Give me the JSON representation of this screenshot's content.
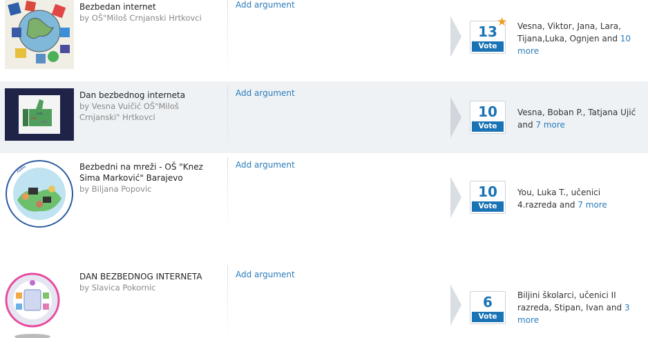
{
  "entries": [
    {
      "title": "Bezbedan internet",
      "byline": "by OŠ\"Miloš Crnjanski Hrtkovci",
      "add_argument": "Add argument",
      "votes": "13",
      "vote_label": "Vote",
      "voters": "Vesna, Viktor, Jana, Lara, Tijana,Luka, Ognjen and",
      "more": "10 more",
      "starred": true
    },
    {
      "title": "Dan bezbednog interneta",
      "byline": "by Vesna Vuičić OŠ\"Miloš Crnjanski\" Hrtkovci",
      "add_argument": "Add argument",
      "votes": "10",
      "vote_label": "Vote",
      "voters": "Vesna, Boban P., Tatjana Ujić and",
      "more": "7 more"
    },
    {
      "title": "Bezbedni na mreži - OŠ \"Knez Sima Marković\" Barajevo",
      "byline": "by Biljana Popovic",
      "add_argument": "Add argument",
      "votes": "10",
      "vote_label": "Vote",
      "voters": "You, Luka T., učenici 4.razreda and",
      "more": "7 more"
    },
    {
      "title": "DAN BEZBEDNOG INTERNETA",
      "byline": "by Slavica Pokornic",
      "add_argument": "Add argument",
      "votes": "6",
      "vote_label": "Vote",
      "voters": "Biljini školarci, učenici II razreda, Stipan, Ivan and",
      "more": "3 more"
    }
  ],
  "colors": {
    "accent": "#1a73b5",
    "link": "#2b7bb9",
    "star": "#f29b1a",
    "alt_row": "#eef2f5"
  }
}
